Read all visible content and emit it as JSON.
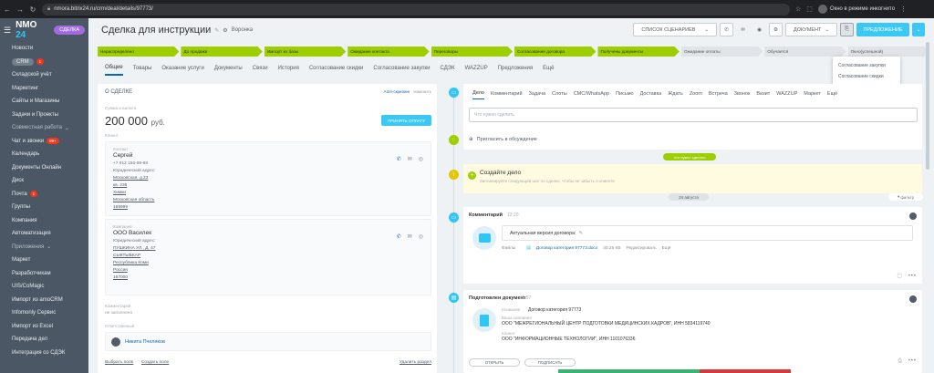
{
  "browser": {
    "url": "nmora.bitrix24.ru/crm/deal/details/97773/",
    "incognito": "Окно в режиме инкогнито"
  },
  "sidebar": {
    "logo_a": "NMO",
    "logo_b": "24",
    "deal_label": "СДЕЛКА",
    "items": [
      {
        "label": "Новости",
        "type": "item"
      },
      {
        "label": "CRM",
        "type": "crm",
        "badge": "1"
      },
      {
        "label": "Складской учёт",
        "type": "item"
      },
      {
        "label": "Маркетинг",
        "type": "item"
      },
      {
        "label": "Сайты и Магазины",
        "type": "item"
      },
      {
        "label": "Задачи и Проекты",
        "type": "item"
      },
      {
        "label": "Совместная работа",
        "type": "group",
        "chevron": "⌄"
      },
      {
        "label": "Чат и звонки",
        "type": "item",
        "badge": "99+"
      },
      {
        "label": "Календарь",
        "type": "item"
      },
      {
        "label": "Документы Онлайн",
        "type": "item"
      },
      {
        "label": "Диск",
        "type": "item"
      },
      {
        "label": "Почта",
        "type": "item",
        "badge": "1"
      },
      {
        "label": "Группы",
        "type": "item"
      },
      {
        "label": "Компания",
        "type": "item"
      },
      {
        "label": "Автоматизация",
        "type": "item"
      },
      {
        "label": "Приложения",
        "type": "group",
        "chevron": "⌄"
      },
      {
        "label": "Маркет",
        "type": "item"
      },
      {
        "label": "Разработчикам",
        "type": "item"
      },
      {
        "label": "UIS/CoMagic",
        "type": "item"
      },
      {
        "label": "Импорт из amoCRM",
        "type": "item"
      },
      {
        "label": "Infomonly Сервис",
        "type": "item"
      },
      {
        "label": "Импорт из Excel",
        "type": "item"
      },
      {
        "label": "Передача дел",
        "type": "item"
      },
      {
        "label": "Интеграция со СДЭК",
        "type": "item"
      }
    ]
  },
  "header": {
    "title": "Сделка для инструкции",
    "funnel": "Воронка",
    "scenarios": "СПИСОК СЦЕНАРИЕВ",
    "document": "ДОКУМЕНТ",
    "primary": "ПРЕДЛОЖЕНИЕ"
  },
  "stages": [
    {
      "label": "Нераспределено",
      "state": "done"
    },
    {
      "label": "До продажи",
      "state": "done"
    },
    {
      "label": "Импорт из базы",
      "state": "done"
    },
    {
      "label": "Ожидание контакта",
      "state": "done"
    },
    {
      "label": "Переговоры",
      "state": "done"
    },
    {
      "label": "Согласование договора",
      "state": "done"
    },
    {
      "label": "Получены документы",
      "state": "done"
    },
    {
      "label": "Ожидание оплаты",
      "state": "todo"
    },
    {
      "label": "Обучается",
      "state": "todo"
    },
    {
      "label": "Окно(успешной)",
      "state": "todo"
    }
  ],
  "tabs": [
    {
      "label": "Общие",
      "active": true
    },
    {
      "label": "Товары"
    },
    {
      "label": "Оказание услуги"
    },
    {
      "label": "Документы"
    },
    {
      "label": "Связи"
    },
    {
      "label": "История"
    },
    {
      "label": "Согласование скидки"
    },
    {
      "label": "Согласование закупки"
    },
    {
      "label": "СДЭК"
    },
    {
      "label": "WAZZUP"
    },
    {
      "label": "Предложения"
    },
    {
      "label": "Ещё"
    }
  ],
  "dropdown": [
    "Согласование закупки",
    "Согласование скидки"
  ],
  "deal": {
    "section": "О СДЕЛКЕ",
    "ai_label": "AI24-скрипинг",
    "change": "изменить",
    "amount_label": "Сумма и валюта",
    "amount": "200 000",
    "currency": "руб.",
    "pay_button": "ПРИНЯТЬ ОПЛАТУ",
    "client_label": "Клиент",
    "contact": {
      "kind": "Контакт",
      "name": "Сергей",
      "phone": "+7 912 156-99-88",
      "address_label": "Юридический адрес:",
      "address": [
        "Московская, д.23",
        "кв. 236",
        "Химки",
        "Московская область",
        "169999"
      ]
    },
    "company": {
      "kind": "Компания",
      "name": "ООО Василек",
      "address_label": "Юридический адрес:",
      "address": [
        "ПУШКИНА УЛ., Д. 47",
        "СЫКТЫВКАР",
        "Республика Коми",
        "Россия",
        "167000"
      ]
    },
    "comment_label": "Комментарий",
    "comment_value": "не заполнено",
    "responsible_label": "Ответственный",
    "responsible_name": "Никита Пчеляков",
    "foot_select": "Выбрать поле",
    "foot_create": "Создать поле",
    "foot_delete": "Удалить раздел"
  },
  "activity": {
    "tabs": [
      "Дело",
      "Комментарий",
      "Задача",
      "Слоты",
      "СМС/WhatsApp",
      "Письмо",
      "Доставка",
      "Ждать",
      "Zoom",
      "Встреча",
      "Звонок",
      "Визит",
      "WAZZUP",
      "Маркет",
      "Ещё"
    ],
    "placeholder": "Что нужно сделать",
    "invite": "Пригласить в обсуждение",
    "todo_badge": "Что нужно сделать",
    "create_title": "Создайте дело",
    "create_sub": "Запланируйте следующий шаг по сделке, чтобы не забыть о клиенте",
    "date": "24 августа",
    "filter": "фильтр"
  },
  "comment_card": {
    "title": "Комментарий",
    "time": "12:20",
    "text": "Актуальная версия договора:",
    "files_label": "Файлы",
    "file_name": "Договор категория 97773.docx",
    "file_size": "40.25 КБ",
    "edit": "Редактировать",
    "more": "Ещё"
  },
  "doc_card": {
    "title": "Подготовлен документ",
    "time": "11:57",
    "rows": [
      {
        "k": "Название",
        "v": "Договор категория 97773"
      },
      {
        "k": "Ваша компания",
        "v": "ООО \"МЕЖРЕГИОНАЛЬНЫЙ ЦЕНТР ПОДГОТОВКИ МЕДИЦИНСКИХ КАДРОВ\", ИНН 5834119740"
      },
      {
        "k": "Клиент",
        "v": "ООО \"ИНФОРМАЦИОННЫЕ ТЕХНОЛОГИИ\", ИНН 1101076336"
      }
    ],
    "open": "ОТКРЫТЬ",
    "sign": "ПОДПИСАТЬ"
  },
  "colors": {
    "accent": "#3bc8f5",
    "stage_done": "#9dcf00",
    "sidebar": "#4b5764"
  }
}
